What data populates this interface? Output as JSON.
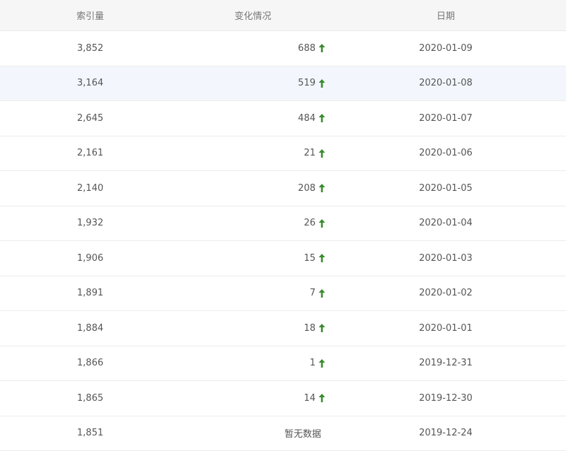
{
  "table": {
    "headers": [
      "索引量",
      "变化情况",
      "日期"
    ],
    "rows": [
      {
        "index": "3,852",
        "change": "688",
        "trend": "up-arrow-icon",
        "date": "2020-01-09"
      },
      {
        "index": "3,164",
        "change": "519",
        "trend": "up-arrow-icon",
        "date": "2020-01-08"
      },
      {
        "index": "2,645",
        "change": "484",
        "trend": "up-arrow-icon",
        "date": "2020-01-07"
      },
      {
        "index": "2,161",
        "change": "21",
        "trend": "up-arrow-icon",
        "date": "2020-01-06"
      },
      {
        "index": "2,140",
        "change": "208",
        "trend": "up-arrow-icon",
        "date": "2020-01-05"
      },
      {
        "index": "1,932",
        "change": "26",
        "trend": "up-arrow-icon",
        "date": "2020-01-04"
      },
      {
        "index": "1,906",
        "change": "15",
        "trend": "up-arrow-icon",
        "date": "2020-01-03"
      },
      {
        "index": "1,891",
        "change": "7",
        "trend": "up-arrow-icon",
        "date": "2020-01-02"
      },
      {
        "index": "1,884",
        "change": "18",
        "trend": "up-arrow-icon",
        "date": "2020-01-01"
      },
      {
        "index": "1,866",
        "change": "1",
        "trend": "up-arrow-icon",
        "date": "2019-12-31"
      },
      {
        "index": "1,865",
        "change": "14",
        "trend": "up-arrow-icon",
        "date": "2019-12-30"
      },
      {
        "index": "1,851",
        "change": "暂无数据",
        "trend": "",
        "date": "2019-12-24"
      }
    ],
    "highlighted_row": 1
  },
  "colors": {
    "up_arrow": "#3a8a2f",
    "header_bg": "#f6f6f6",
    "highlight_bg": "#f3f7fd"
  }
}
